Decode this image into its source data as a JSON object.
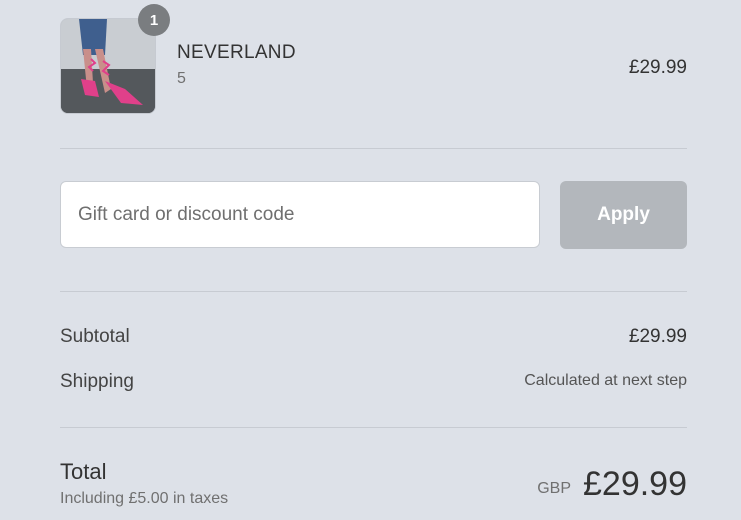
{
  "product": {
    "name": "NEVERLAND",
    "variant": "5",
    "price": "£29.99",
    "quantity_badge": "1",
    "image_icon": "product-thumbnail-pink-heels"
  },
  "discount": {
    "placeholder": "Gift card or discount code",
    "apply_label": "Apply"
  },
  "summary": {
    "subtotal_label": "Subtotal",
    "subtotal_value": "£29.99",
    "shipping_label": "Shipping",
    "shipping_value": "Calculated at next step"
  },
  "total": {
    "label": "Total",
    "tax_note": "Including £5.00 in taxes",
    "currency": "GBP",
    "value": "£29.99"
  },
  "colors": {
    "background": "#dde1e8",
    "apply_button": "#b3b7bc",
    "badge": "#7a7d80"
  }
}
